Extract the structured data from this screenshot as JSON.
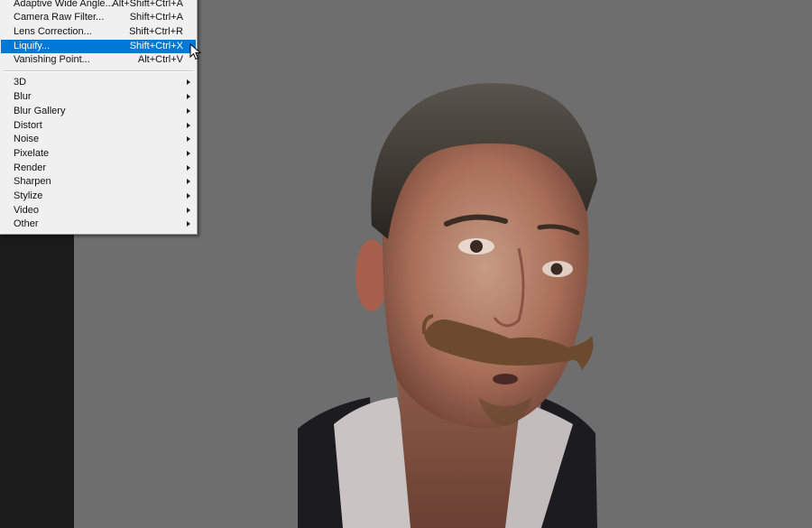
{
  "filter_menu": {
    "items_top": [
      {
        "label": "Adaptive Wide Angle...",
        "shortcut": "Alt+Shift+Ctrl+A"
      },
      {
        "label": "Camera Raw Filter...",
        "shortcut": "Shift+Ctrl+A"
      },
      {
        "label": "Lens Correction...",
        "shortcut": "Shift+Ctrl+R"
      },
      {
        "label": "Liquify...",
        "shortcut": "Shift+Ctrl+X",
        "selected": true
      },
      {
        "label": "Vanishing Point...",
        "shortcut": "Alt+Ctrl+V"
      }
    ],
    "submenus": [
      {
        "label": "3D"
      },
      {
        "label": "Blur"
      },
      {
        "label": "Blur Gallery"
      },
      {
        "label": "Distort"
      },
      {
        "label": "Noise"
      },
      {
        "label": "Pixelate"
      },
      {
        "label": "Render"
      },
      {
        "label": "Sharpen"
      },
      {
        "label": "Stylize"
      },
      {
        "label": "Video"
      },
      {
        "label": "Other"
      }
    ]
  },
  "colors": {
    "menu_highlight": "#0078d7",
    "canvas_bg": "#6e6e6e",
    "panel_bg": "#1b1b1b"
  }
}
